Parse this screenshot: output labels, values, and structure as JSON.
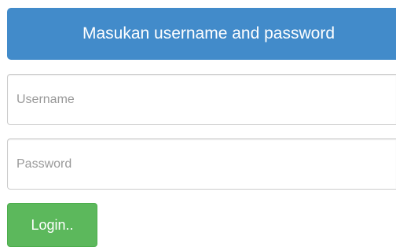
{
  "header": {
    "title": "Masukan username and password"
  },
  "form": {
    "username": {
      "value": "",
      "placeholder": "Username"
    },
    "password": {
      "value": "",
      "placeholder": "Password"
    },
    "login_label": "Login.."
  },
  "colors": {
    "banner": "#428bca",
    "button": "#5cb85c",
    "field_border": "#cccccc",
    "placeholder": "#999999"
  }
}
